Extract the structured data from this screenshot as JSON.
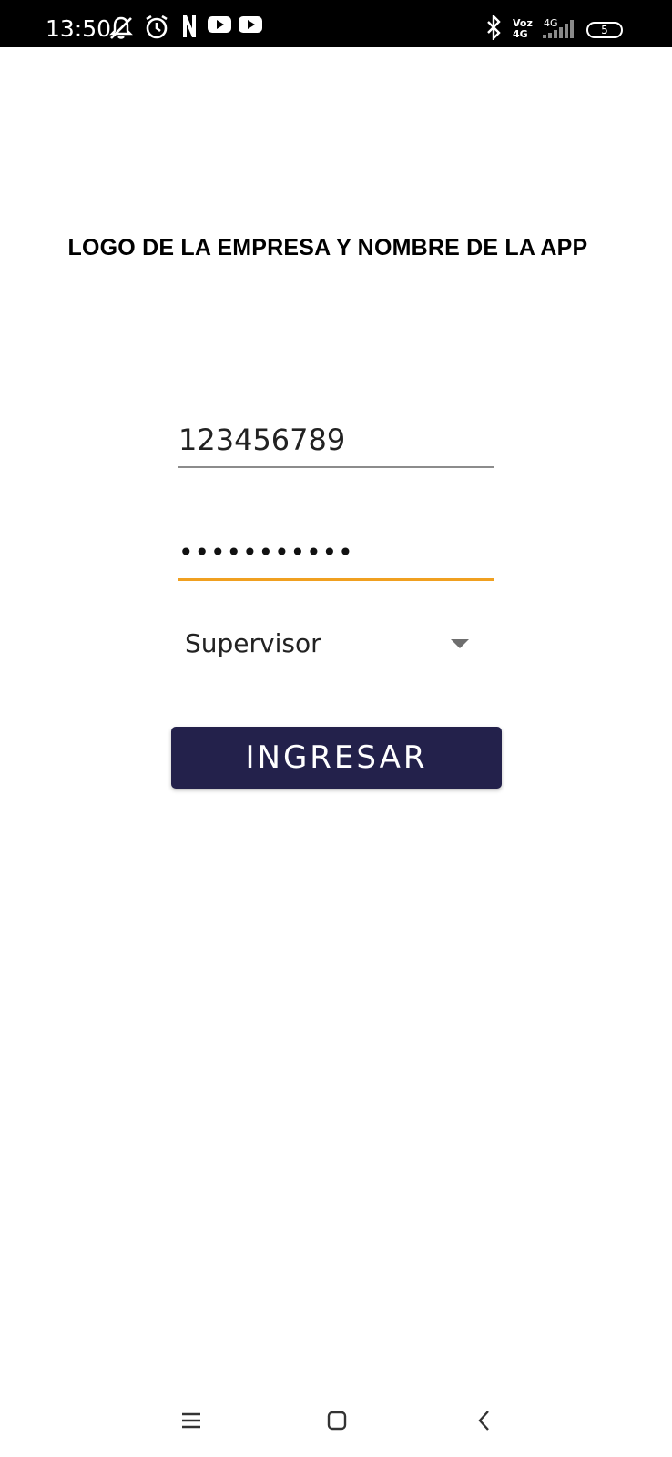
{
  "status_bar": {
    "time": "13:50",
    "network_label_top": "Voz",
    "network_label_bottom": "4G",
    "signal_label": "4G",
    "battery_level": "5",
    "icons": [
      "mute-icon",
      "alarm-icon",
      "netflix-icon",
      "youtube-icon",
      "youtube-icon",
      "bluetooth-icon",
      "signal-icon",
      "battery-icon"
    ]
  },
  "header": {
    "title": "LOGO DE LA EMPRESA Y NOMBRE DE LA APP"
  },
  "login": {
    "user_value": "123456789",
    "password_masked": "•••••••••••",
    "role_selected": "Supervisor",
    "submit_label": "INGRESAR"
  },
  "colors": {
    "button_bg": "#23214b",
    "focus_underline": "#f0a020",
    "status_bar_bg": "#000000"
  },
  "nav_bar": {
    "icons": [
      "menu-icon",
      "home-icon",
      "back-icon"
    ]
  }
}
